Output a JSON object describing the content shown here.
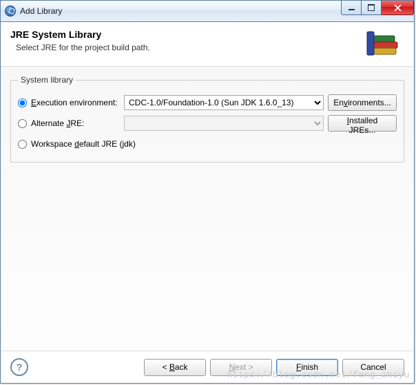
{
  "window": {
    "title": "Add Library"
  },
  "header": {
    "title": "JRE System Library",
    "subtitle": "Select JRE for the project build path."
  },
  "group": {
    "legend": "System library",
    "options": {
      "execEnv": {
        "prefix": "E",
        "label": "xecution environment:",
        "selected": true,
        "value": "CDC-1.0/Foundation-1.0 (Sun JDK 1.6.0_13)"
      },
      "altJre": {
        "label_pre": "Alternate ",
        "u": "J",
        "label_post": "RE:",
        "selected": false,
        "value": ""
      },
      "workspace": {
        "label_pre": "Workspace ",
        "u": "d",
        "label_post": "efault JRE (jdk)",
        "selected": false
      }
    },
    "buttons": {
      "environments": {
        "u": "v",
        "pre": "En",
        "post": "ironments..."
      },
      "installed": {
        "u": "I",
        "pre": "",
        "post": "nstalled JREs..."
      }
    }
  },
  "footer": {
    "back": {
      "pre": "< ",
      "u": "B",
      "post": "ack"
    },
    "next": {
      "u": "N",
      "post": "ext >"
    },
    "finish": {
      "u": "F",
      "post": "inish"
    },
    "cancel": "Cancel"
  },
  "watermark": "https://blog.csdn.net/feng_zhiyu"
}
